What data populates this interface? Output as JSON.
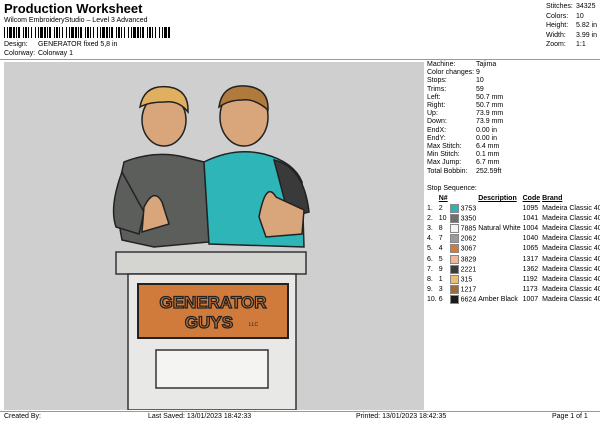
{
  "header": {
    "title": "Production Worksheet",
    "subtitle": "Wilcom EmbroideryStudio – Level 3 Advanced",
    "design_label": "Design:",
    "design_value": "GENERATOR fixed 5,8 in",
    "colorway_label": "Colorway:",
    "colorway_value": "Colorway 1"
  },
  "stats": [
    {
      "label": "Stitches:",
      "value": "34325"
    },
    {
      "label": "Colors:",
      "value": "10"
    },
    {
      "label": "Height:",
      "value": "5.82 in"
    },
    {
      "label": "Width:",
      "value": "3.99 in"
    },
    {
      "label": "Zoom:",
      "value": "1:1"
    }
  ],
  "artwork": {
    "sign_line1": "GENERATOR",
    "sign_line2": "GUYS",
    "sign_llc": "LLC"
  },
  "machine_info": [
    {
      "label": "Machine:",
      "value": "Tajima"
    },
    {
      "label": "Color changes:",
      "value": "9"
    },
    {
      "label": "Stops:",
      "value": "10"
    },
    {
      "label": "Trims:",
      "value": "59"
    },
    {
      "label": "Left:",
      "value": "50.7 mm"
    },
    {
      "label": "Right:",
      "value": "50.7 mm"
    },
    {
      "label": "Up:",
      "value": "73.9 mm"
    },
    {
      "label": "Down:",
      "value": "73.9 mm"
    },
    {
      "label": "EndX:",
      "value": "0.00 in"
    },
    {
      "label": "EndY:",
      "value": "0.00 in"
    },
    {
      "label": "Max Stitch:",
      "value": "6.4 mm"
    },
    {
      "label": "Min Stitch:",
      "value": "0.1 mm"
    },
    {
      "label": "Max Jump:",
      "value": "6.7 mm"
    },
    {
      "label": "Total Bobbin:",
      "value": "252.59ft"
    }
  ],
  "stop_sequence": {
    "heading": "Stop Sequence:",
    "columns": [
      "N#",
      "Description",
      "Code",
      "Brand"
    ],
    "rows": [
      {
        "stop": "1.",
        "n": "2",
        "color": "#2bb3b8",
        "num": "3753",
        "desc": "",
        "code": "1095",
        "brand": "Madeira Classic 40"
      },
      {
        "stop": "2.",
        "n": "10",
        "color": "#6f6f6f",
        "num": "3350",
        "desc": "",
        "code": "1041",
        "brand": "Madeira Classic 40"
      },
      {
        "stop": "3.",
        "n": "8",
        "color": "#f4f4f4",
        "num": "7885",
        "desc": "Natural White",
        "code": "1004",
        "brand": "Madeira Classic 40"
      },
      {
        "stop": "4.",
        "n": "7",
        "color": "#9a9a9a",
        "num": "2062",
        "desc": "",
        "code": "1040",
        "brand": "Madeira Classic 40"
      },
      {
        "stop": "5.",
        "n": "4",
        "color": "#d07a3c",
        "num": "3067",
        "desc": "",
        "code": "1065",
        "brand": "Madeira Classic 40"
      },
      {
        "stop": "6.",
        "n": "5",
        "color": "#f0b89a",
        "num": "3829",
        "desc": "",
        "code": "1317",
        "brand": "Madeira Classic 40"
      },
      {
        "stop": "7.",
        "n": "9",
        "color": "#3c3c3c",
        "num": "2221",
        "desc": "",
        "code": "1362",
        "brand": "Madeira Classic 40"
      },
      {
        "stop": "8.",
        "n": "1",
        "color": "#e8c070",
        "num": "315",
        "desc": "",
        "code": "1192",
        "brand": "Madeira Classic 40"
      },
      {
        "stop": "9.",
        "n": "3",
        "color": "#a06a3c",
        "num": "1217",
        "desc": "",
        "code": "1173",
        "brand": "Madeira Classic 40"
      },
      {
        "stop": "10.",
        "n": "6",
        "color": "#1a1a1a",
        "num": "6624",
        "desc": "Amber Black",
        "code": "1007",
        "brand": "Madeira Classic 40"
      }
    ]
  },
  "footer": {
    "created_by": "Created By:",
    "last_saved": "Last Saved: 13/01/2023 18:42:33",
    "printed": "Printed: 13/01/2023 18:42:35",
    "page": "Page 1 of 1"
  }
}
